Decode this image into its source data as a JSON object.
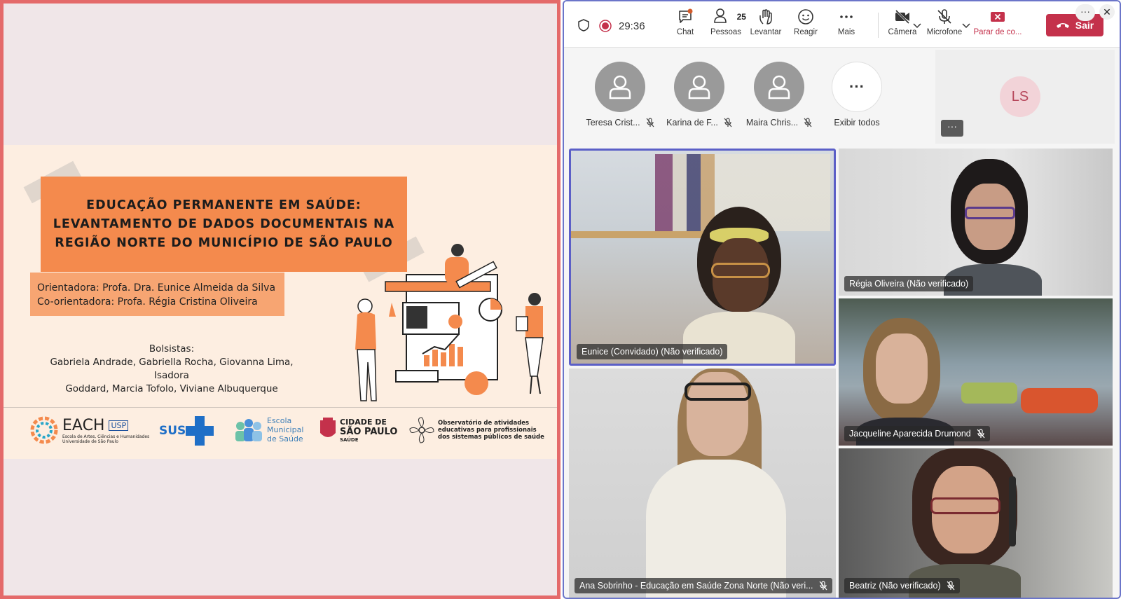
{
  "slide": {
    "title_lines": [
      "EDUCAÇÃO PERMANENTE EM SAÚDE:",
      "LEVANTAMENTO DE DADOS DOCUMENTAIS NA",
      "REGIÃO NORTE DO MUNICÍPIO DE SÃO PAULO"
    ],
    "advisor": "Orientadora: Profa. Dra. Eunice Almeida da Silva",
    "coadvisor": "Co-orientadora: Profa. Régia Cristina Oliveira",
    "fellows_label": "Bolsistas:",
    "fellows_line1": "Gabriela Andrade, Gabriella Rocha, Giovanna Lima, Isadora",
    "fellows_line2": "Goddard, Marcia Tofolo, Viviane Albuquerque",
    "logos": {
      "each_name": "EACH",
      "each_sub1": "Escola de Artes, Ciências e Humanidades",
      "each_sub2": "Universidade de São Paulo",
      "usp": "USP",
      "sus": "SUS",
      "escola_1": "Escola",
      "escola_2": "Municipal",
      "escola_3": "de Saúde",
      "cidade_1": "CIDADE DE",
      "cidade_2": "SÃO PAULO",
      "cidade_3": "SAÚDE",
      "obs_1": "Observatório de atividades",
      "obs_2": "educativas para profissionais",
      "obs_3": "dos sistemas públicos de saúde"
    },
    "accent_color": "#f48a4d"
  },
  "toolbar": {
    "timer": "29:36",
    "chat": "Chat",
    "people": "Pessoas",
    "people_count": "25",
    "raise": "Levantar",
    "react": "Reagir",
    "more": "Mais",
    "camera": "Câmera",
    "mic": "Microfone",
    "stop_share": "Parar de co...",
    "leave": "Sair",
    "leave_color": "#c4314b"
  },
  "attendees": [
    {
      "name": "Teresa Crist..."
    },
    {
      "name": "Karina de F..."
    },
    {
      "name": "Maira Chris..."
    }
  ],
  "show_all": "Exibir todos",
  "self_initials": "LS",
  "tiles": {
    "eunice": "Eunice (Convidado) (Não verificado)",
    "regia": "Régia Oliveira (Não verificado)",
    "jacqueline": "Jacqueline Aparecida Drumond",
    "ana": "Ana Sobrinho - Educação em Saúde Zona Norte (Não veri...",
    "beatriz": "Beatriz (Não verificado)"
  }
}
